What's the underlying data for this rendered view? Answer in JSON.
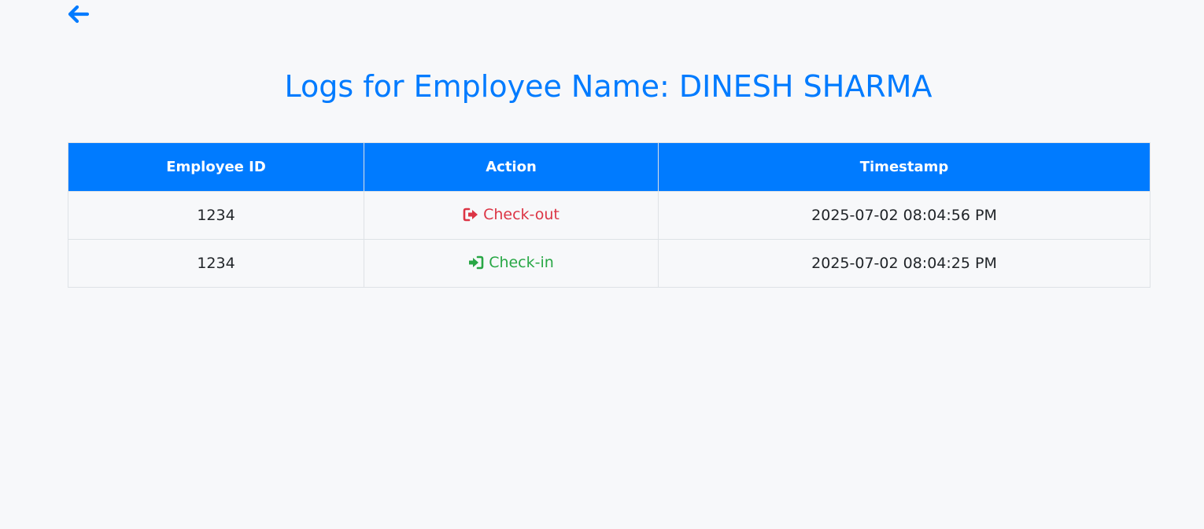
{
  "header": {
    "back_icon": "arrow-left-icon",
    "title": "Logs for Employee Name: DINESH SHARMA"
  },
  "colors": {
    "accent": "#007bff",
    "checkout": "#dc3545",
    "checkin": "#28a745"
  },
  "table": {
    "columns": [
      "Employee ID",
      "Action",
      "Timestamp"
    ],
    "rows": [
      {
        "employee_id": "1234",
        "action": "Check-out",
        "action_icon": "sign-out-icon",
        "timestamp": "2025-07-02 08:04:56 PM"
      },
      {
        "employee_id": "1234",
        "action": "Check-in",
        "action_icon": "sign-in-icon",
        "timestamp": "2025-07-02 08:04:25 PM"
      }
    ]
  }
}
